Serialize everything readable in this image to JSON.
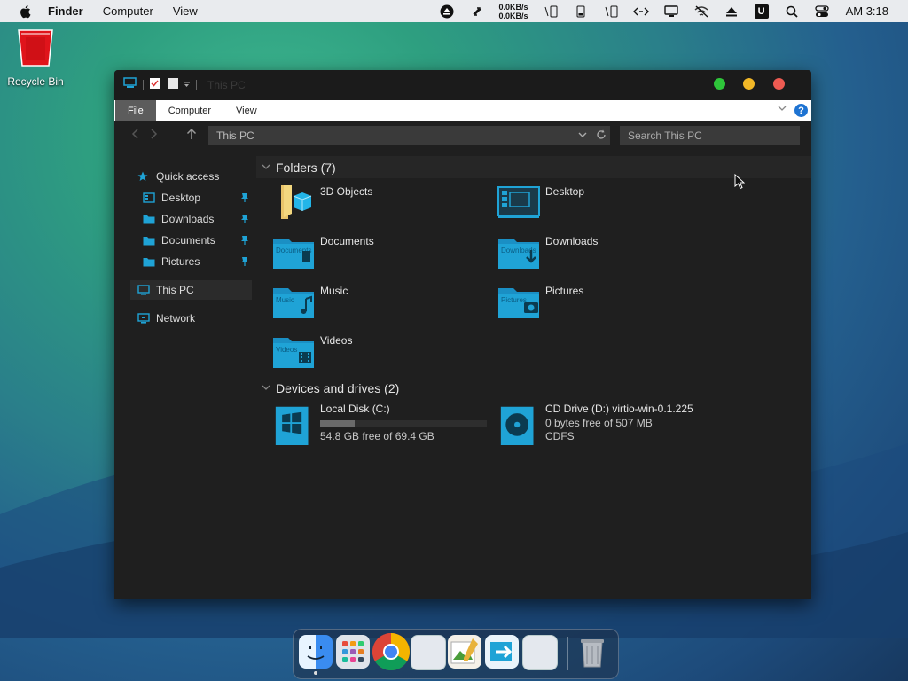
{
  "menubar": {
    "app_name": "Finder",
    "menus": [
      "Computer",
      "View"
    ],
    "net_up": "0.0KB/s",
    "net_down": "0.0KB/s",
    "clock": "AM 3:18",
    "u_badge": "U"
  },
  "desktop": {
    "recycle_bin_label": "Recycle Bin"
  },
  "window": {
    "title": "This PC",
    "ribbon_tabs": [
      "File",
      "Computer",
      "View"
    ],
    "help": "?",
    "address": "This PC",
    "search_placeholder": "Search This PC",
    "nav": {
      "quick_access": "Quick access",
      "desktop": "Desktop",
      "downloads": "Downloads",
      "documents": "Documents",
      "pictures": "Pictures",
      "this_pc": "This PC",
      "network": "Network"
    },
    "folders_header": "Folders (7)",
    "folders": {
      "objects3d": "3D Objects",
      "desktop": "Desktop",
      "documents": "Documents",
      "downloads": "Downloads",
      "music": "Music",
      "pictures": "Pictures",
      "videos": "Videos"
    },
    "folder_overlay_labels": {
      "documents": "Documents",
      "downloads": "Downloads",
      "music": "Music",
      "pictures": "Pictures",
      "videos": "Videos"
    },
    "devices_header": "Devices and drives (2)",
    "drives": {
      "c_name": "Local Disk (C:)",
      "c_free": "54.8 GB free of 69.4 GB",
      "c_used_fraction": 0.21,
      "d_name": "CD Drive (D:) virtio-win-0.1.225",
      "d_free": "0 bytes free of 507 MB",
      "d_fs": "CDFS"
    }
  },
  "colors": {
    "accent_cyan": "#1fa3d6",
    "close": "#ee5b52",
    "minimize": "#f2b827",
    "zoom": "#2ec53a"
  },
  "dock_apps": [
    "finder-icon",
    "launchpad-icon",
    "chrome-icon",
    "blank-app-icon",
    "image-editor-icon",
    "migration-icon",
    "blank-app-icon",
    "trash-icon"
  ]
}
